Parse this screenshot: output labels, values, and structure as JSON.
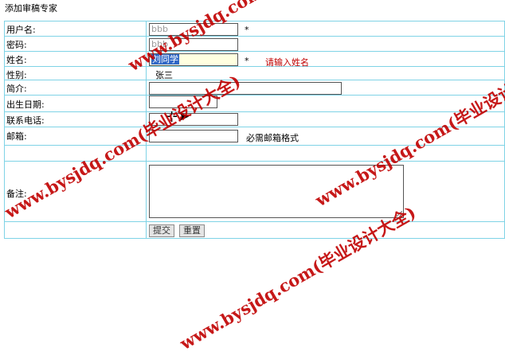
{
  "page": {
    "title": "添加审稿专家"
  },
  "form": {
    "username": {
      "label": "用户名:",
      "value": "bbb",
      "required_mark": "*"
    },
    "password": {
      "label": "密码:",
      "value": "bbb"
    },
    "name": {
      "label": "姓名:",
      "value": "刘同学",
      "required_mark": "*",
      "error": "请输入姓名",
      "suggestion": "张三"
    },
    "gender": {
      "label": "性别:"
    },
    "intro": {
      "label": "简介:"
    },
    "birthday": {
      "label": "出生日期:"
    },
    "phone": {
      "label": "联系电话:"
    },
    "email": {
      "label": "邮箱:",
      "hint": "必需邮箱格式"
    },
    "remark": {
      "label": "备注:"
    },
    "buttons": {
      "submit": "提交",
      "reset": "重置"
    }
  },
  "watermarks": [
    "www.bysjdq.com(毕业设计大全)",
    "www.bysjdq.com(毕业设计大全)",
    "www.bysjdq.com(毕业设计大全)",
    "www.bysjdq.com(毕业设计大全)"
  ]
}
